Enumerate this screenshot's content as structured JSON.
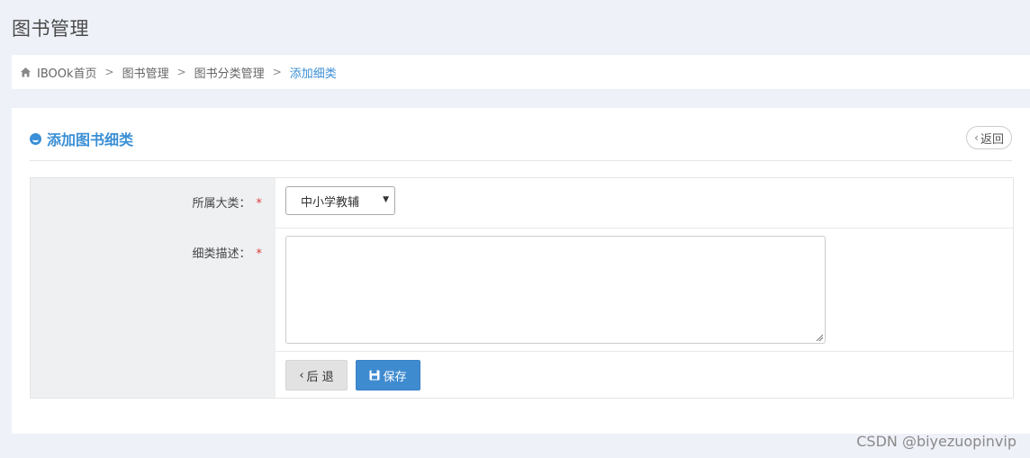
{
  "page": {
    "title": "图书管理"
  },
  "breadcrumb": {
    "items": [
      "IBOOk首页",
      "图书管理",
      "图书分类管理"
    ],
    "active": "添加细类",
    "separator": ">"
  },
  "panel": {
    "title": "添加图书细类",
    "back_link": "返回"
  },
  "form": {
    "category_label": "所属大类：",
    "category_required": "*",
    "category_value": "中小学教辅",
    "description_label": "细类描述：",
    "description_required": "*",
    "description_value": "",
    "back_button": "后 退",
    "save_button": "保存"
  },
  "watermark": "CSDN @biyezuopinvip",
  "colors": {
    "accent": "#3a8fd6",
    "required": "#e03b3b",
    "save": "#3f8bd0"
  }
}
